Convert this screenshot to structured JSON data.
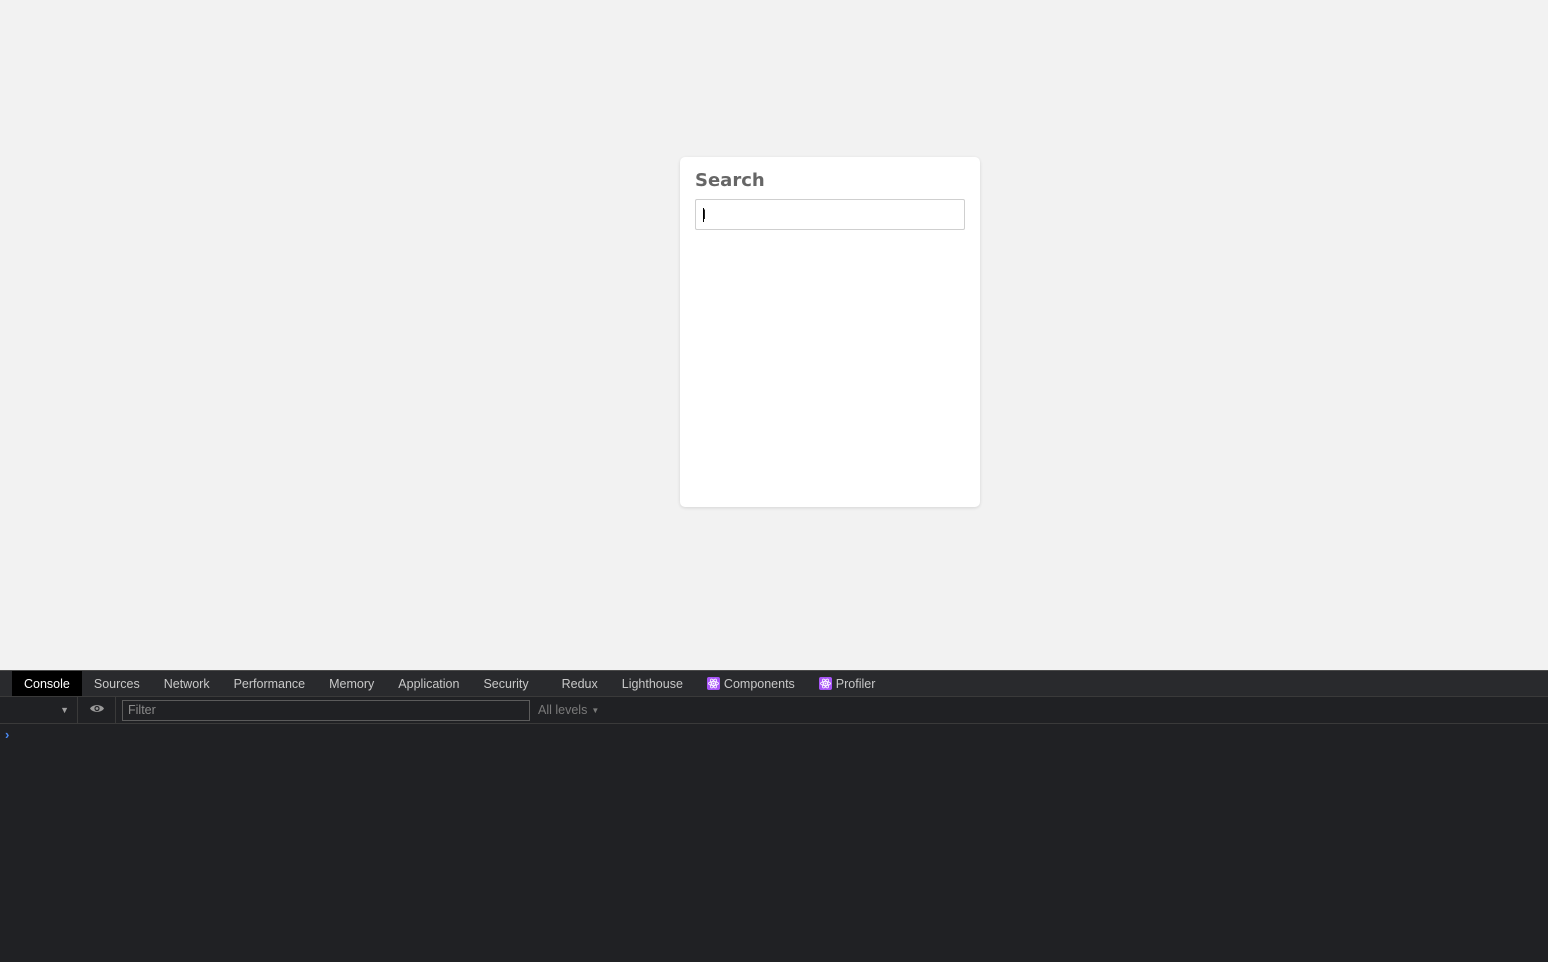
{
  "page": {
    "card": {
      "title": "Search",
      "input_value": "l",
      "input_placeholder": ""
    }
  },
  "devtools": {
    "tabs": [
      {
        "label": "Console",
        "active": true
      },
      {
        "label": "Sources"
      },
      {
        "label": "Network"
      },
      {
        "label": "Performance"
      },
      {
        "label": "Memory"
      },
      {
        "label": "Application"
      },
      {
        "label": "Security"
      },
      {
        "label": "Redux"
      },
      {
        "label": "Lighthouse"
      },
      {
        "label": "Components",
        "icon": "react-icon"
      },
      {
        "label": "Profiler",
        "icon": "react-icon"
      }
    ],
    "toolbar": {
      "context_arrow": "▼",
      "filter_placeholder": "Filter",
      "levels_label": "All levels",
      "levels_arrow": "▼"
    },
    "console": {
      "prompt": "›"
    },
    "colors": {
      "active_tab_bg": "#000000",
      "panel_bg": "#202124",
      "react_icon": "#a855f7",
      "prompt": "#4a8af4"
    }
  }
}
